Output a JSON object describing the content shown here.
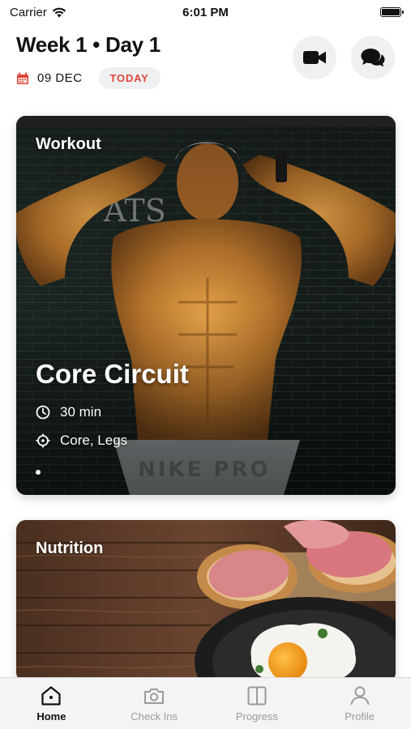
{
  "status_bar": {
    "carrier": "Carrier",
    "time": "6:01 PM"
  },
  "header": {
    "title": "Week 1 • Day 1",
    "date": "09 DEC",
    "today_badge": "TODAY",
    "accent_color": "#e0473a"
  },
  "workout_card": {
    "label": "Workout",
    "title": "Core Circuit",
    "duration": "30 min",
    "focus": "Core, Legs"
  },
  "nutrition_card": {
    "label": "Nutrition"
  },
  "tab_bar": {
    "tabs": [
      {
        "label": "Home",
        "icon": "home-icon",
        "active": true
      },
      {
        "label": "Check Ins",
        "icon": "camera-icon",
        "active": false
      },
      {
        "label": "Progress",
        "icon": "compare-icon",
        "active": false
      },
      {
        "label": "Profile",
        "icon": "user-icon",
        "active": false
      }
    ]
  }
}
